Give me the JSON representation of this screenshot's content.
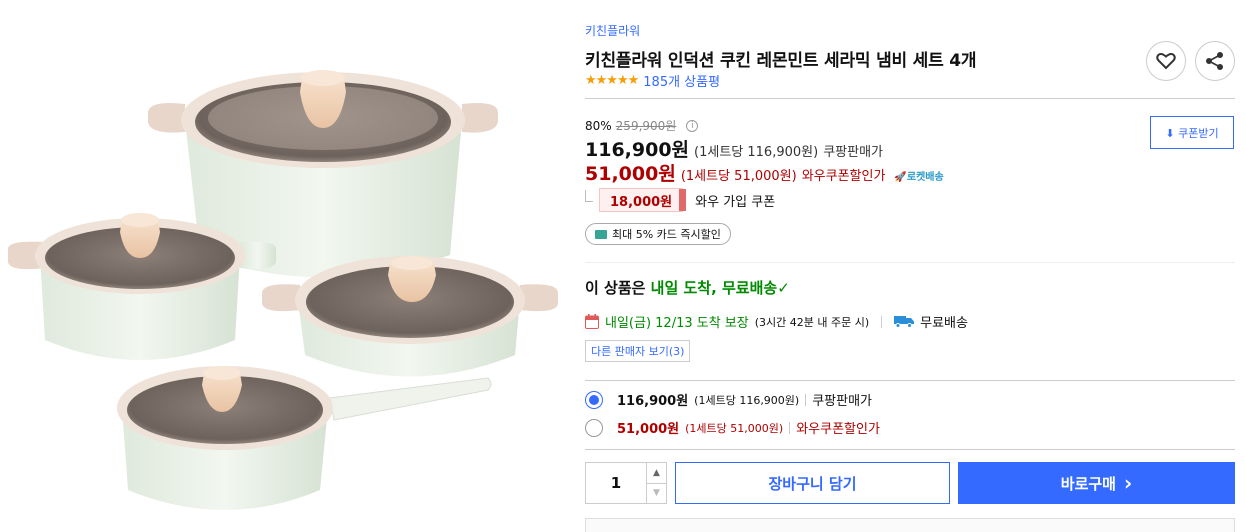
{
  "product": {
    "brand": "키친플라워",
    "title": "키친플라워 인덕션 쿠킨 레몬민트 세라믹 냄비 세트 4개",
    "stars": "★★★★★",
    "review_count": "185개 상품평",
    "image_icon": "cookware-set-image"
  },
  "actions": {
    "wishlist_icon": "heart-icon",
    "share_icon": "share-icon"
  },
  "pricing": {
    "discount_rate": "80%",
    "original_price": "259,900원",
    "info_icon": "i",
    "coupang_price": "116,900원",
    "coupang_unit": "(1세트당 116,900원)",
    "coupang_label": "쿠팡판매가",
    "wow_price": "51,000원",
    "wow_unit": "(1세트당 51,000원)",
    "wow_label": "와우쿠폰할인가",
    "rocket_label": "🚀로켓배송",
    "coupon_button": "⬇ 쿠폰받기",
    "wow_coupon_amount": "18,000원",
    "wow_coupon_label": "와우 가입 쿠폰",
    "card_discount": "최대 5% 카드 즉시할인"
  },
  "delivery": {
    "head_prefix": "이 상품은 ",
    "head_highlight": "내일 도착, 무료배송",
    "head_check": "✓",
    "arrival": "내일(금) 12/13 도착 보장",
    "arrival_note": "(3시간 42분 내 주문 시)",
    "free_shipping": "무료배송",
    "other_sellers": "다른 판매자 보기(3)"
  },
  "options": [
    {
      "price": "116,900원",
      "unit": "(1세트당 116,900원)",
      "label": "쿠팡판매가",
      "selected": true
    },
    {
      "price": "51,000원",
      "unit": "(1세트당 51,000원)",
      "label": "와우쿠폰할인가",
      "selected": false
    }
  ],
  "purchase": {
    "quantity": "1",
    "qty_up": "▲",
    "qty_down": "▼",
    "cart_button": "장바구니 담기",
    "buy_button": "바로구매",
    "buy_chevron": "›"
  },
  "colors": {
    "accent": "#346aff",
    "price_red": "#ae0000",
    "green": "#008a00",
    "pot_body": "#e9f2e8",
    "lid_knob": "#f3d7bf"
  }
}
